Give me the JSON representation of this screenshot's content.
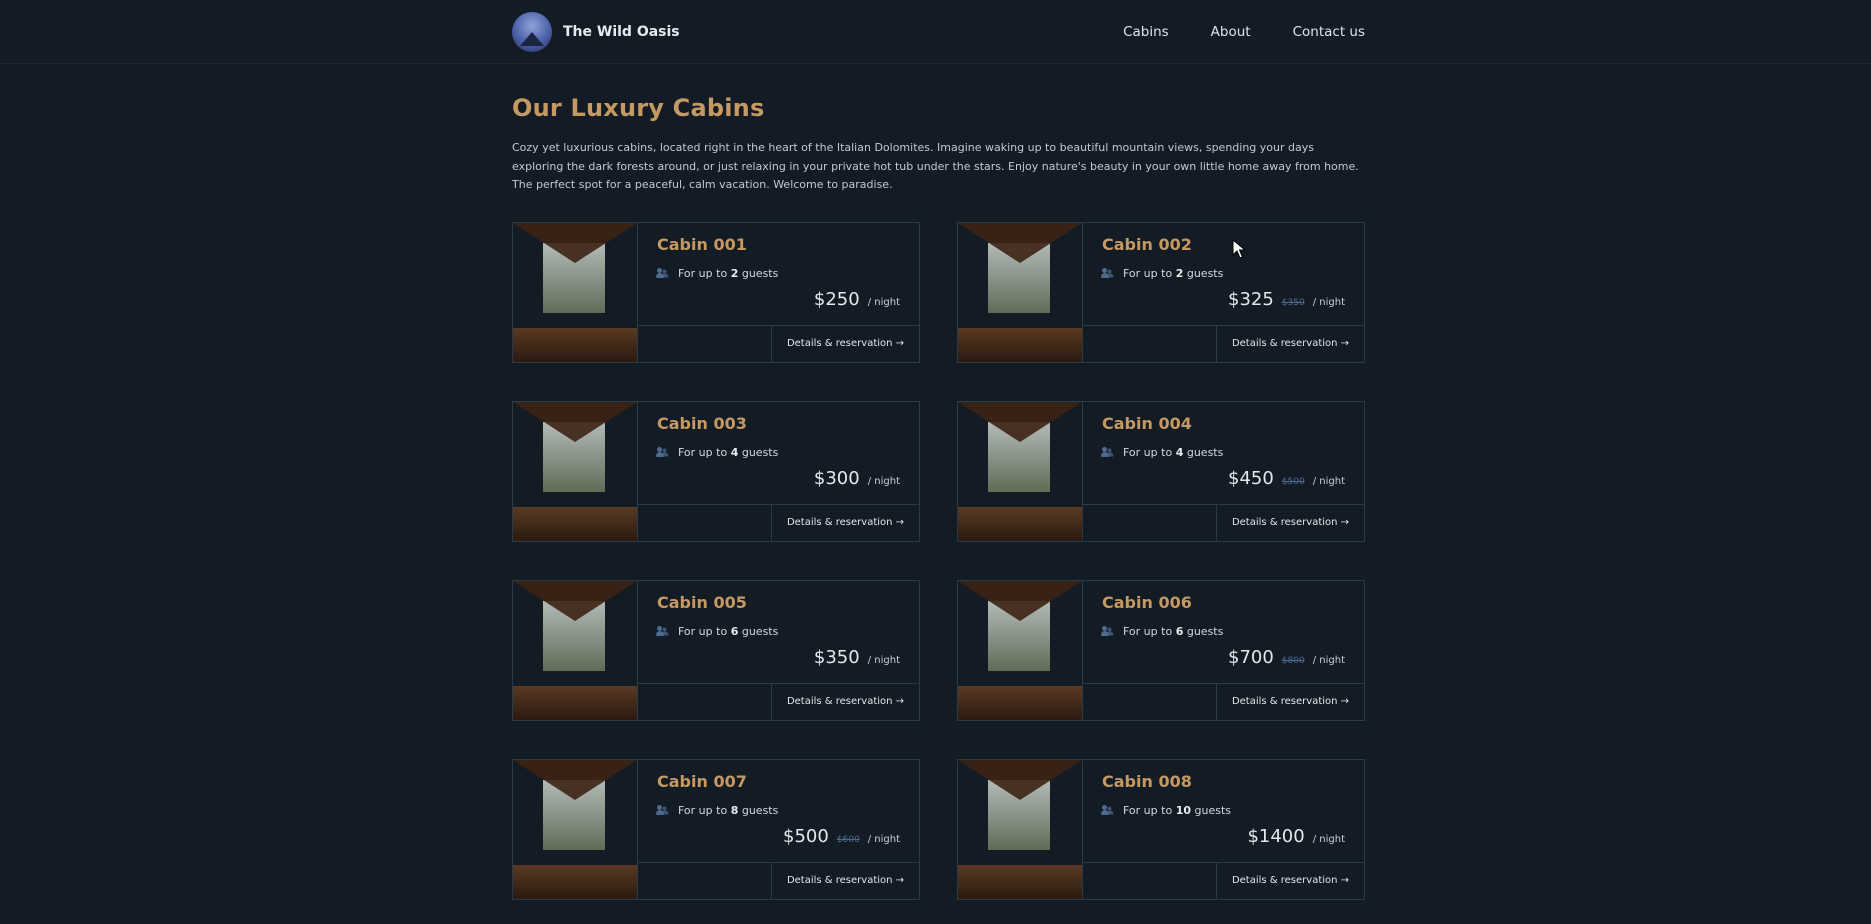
{
  "header": {
    "brand_name": "The Wild Oasis",
    "nav": [
      "Cabins",
      "About",
      "Contact us"
    ]
  },
  "main": {
    "title": "Our Luxury Cabins",
    "intro": "Cozy yet luxurious cabins, located right in the heart of the Italian Dolomites. Imagine waking up to beautiful mountain views, spending your days exploring the dark forests around, or just relaxing in your private hot tub under the stars. Enjoy nature's beauty in your own little home away from home. The perfect spot for a peaceful, calm vacation. Welcome to paradise."
  },
  "cabins": [
    {
      "name": "Cabin 001",
      "guests_prefix": "For up to",
      "guests": "2",
      "guests_suffix": "guests",
      "price": "$250",
      "old_price": "",
      "per_night": "/ night",
      "cta": "Details & reservation →"
    },
    {
      "name": "Cabin 002",
      "guests_prefix": "For up to",
      "guests": "2",
      "guests_suffix": "guests",
      "price": "$325",
      "old_price": "$350",
      "per_night": "/ night",
      "cta": "Details & reservation →"
    },
    {
      "name": "Cabin 003",
      "guests_prefix": "For up to",
      "guests": "4",
      "guests_suffix": "guests",
      "price": "$300",
      "old_price": "",
      "per_night": "/ night",
      "cta": "Details & reservation →"
    },
    {
      "name": "Cabin 004",
      "guests_prefix": "For up to",
      "guests": "4",
      "guests_suffix": "guests",
      "price": "$450",
      "old_price": "$500",
      "per_night": "/ night",
      "cta": "Details & reservation →"
    },
    {
      "name": "Cabin 005",
      "guests_prefix": "For up to",
      "guests": "6",
      "guests_suffix": "guests",
      "price": "$350",
      "old_price": "",
      "per_night": "/ night",
      "cta": "Details & reservation →"
    },
    {
      "name": "Cabin 006",
      "guests_prefix": "For up to",
      "guests": "6",
      "guests_suffix": "guests",
      "price": "$700",
      "old_price": "$800",
      "per_night": "/ night",
      "cta": "Details & reservation →"
    },
    {
      "name": "Cabin 007",
      "guests_prefix": "For up to",
      "guests": "8",
      "guests_suffix": "guests",
      "price": "$500",
      "old_price": "$600",
      "per_night": "/ night",
      "cta": "Details & reservation →"
    },
    {
      "name": "Cabin 008",
      "guests_prefix": "For up to",
      "guests": "10",
      "guests_suffix": "guests",
      "price": "$1400",
      "old_price": "",
      "per_night": "/ night",
      "cta": "Details & reservation →"
    }
  ],
  "icons": {
    "guests": "users-icon",
    "cursor": "mouse-pointer-icon"
  },
  "colors": {
    "accent": "#c69963",
    "background": "#131c24",
    "border": "#2b3a48",
    "muted_blue": "#4e6a8e"
  }
}
